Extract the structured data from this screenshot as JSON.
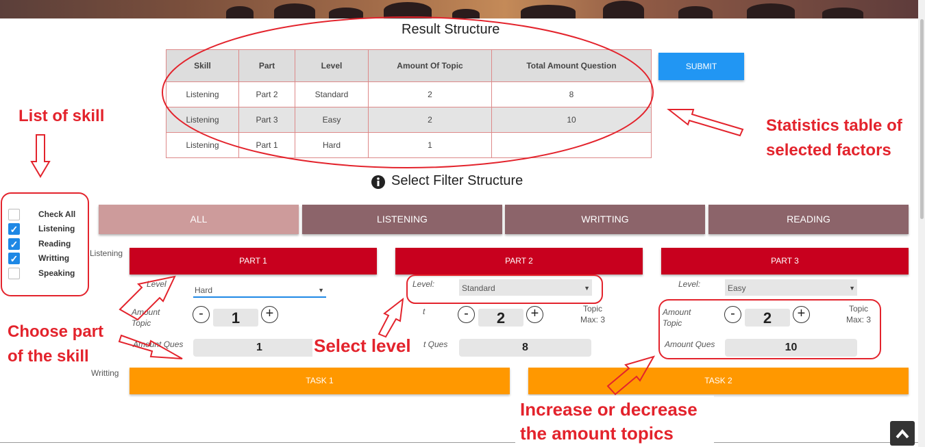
{
  "result": {
    "title": "Result Structure",
    "headers": [
      "Skill",
      "Part",
      "Level",
      "Amount Of Topic",
      "Total Amount Question"
    ],
    "rows": [
      [
        "Listening",
        "Part 2",
        "Standard",
        "2",
        "8"
      ],
      [
        "Listening",
        "Part 3",
        "Easy",
        "2",
        "10"
      ],
      [
        "Listening",
        "Part 1",
        "Hard",
        "1",
        ""
      ]
    ],
    "submit_label": "SUBMIT"
  },
  "filter": {
    "title": "Select Filter Structure",
    "info_icon": "info-circle-icon"
  },
  "skills": [
    {
      "label": "Check All",
      "checked": false
    },
    {
      "label": "Listening",
      "checked": true
    },
    {
      "label": "Reading",
      "checked": true
    },
    {
      "label": "Writting",
      "checked": true
    },
    {
      "label": "Speaking",
      "checked": false
    }
  ],
  "tabs": [
    "ALL",
    "LISTENING",
    "WRITTING",
    "READING"
  ],
  "section_listening": "Listening",
  "section_writting": "Writting",
  "parts": [
    {
      "label": "PART 1",
      "level_label": "Level",
      "level": "Hard",
      "amount_topic_label": "Amount Topic",
      "amount_topic": "1",
      "amount_ques_label": "Amount Ques",
      "amount_ques": "1",
      "topic_max": "",
      "plus": "+",
      "minus": "-"
    },
    {
      "label": "PART 2",
      "level_label": "Level:",
      "level": "Standard",
      "amount_topic_label": "t",
      "amount_topic": "2",
      "amount_ques_label": "t Ques",
      "amount_ques": "8",
      "topic_max": "Topic Max: 3",
      "plus": "+",
      "minus": "-"
    },
    {
      "label": "PART 3",
      "level_label": "Level:",
      "level": "Easy",
      "amount_topic_label": "Amount Topic",
      "amount_topic": "2",
      "amount_ques_label": "Amount Ques",
      "amount_ques": "10",
      "topic_max": "Topic Max: 3",
      "plus": "+",
      "minus": "-"
    }
  ],
  "tasks": [
    "TASK 1",
    "TASK 2"
  ],
  "annotations": {
    "list_of_skill": "List of skill",
    "stats_line1": "Statistics table of",
    "stats_line2": "selected factors",
    "choose_line1": "Choose part",
    "choose_line2": "of the skill",
    "select_level": "Select level",
    "inc_line1": "Increase or decrease",
    "inc_line2": "the amount topics"
  },
  "colors": {
    "accent": "#2196f3",
    "part": "#c8001e",
    "task": "#ff9800",
    "tab_active": "#cd9b9b",
    "tab": "#8c646a",
    "annotation": "#e3232c"
  }
}
